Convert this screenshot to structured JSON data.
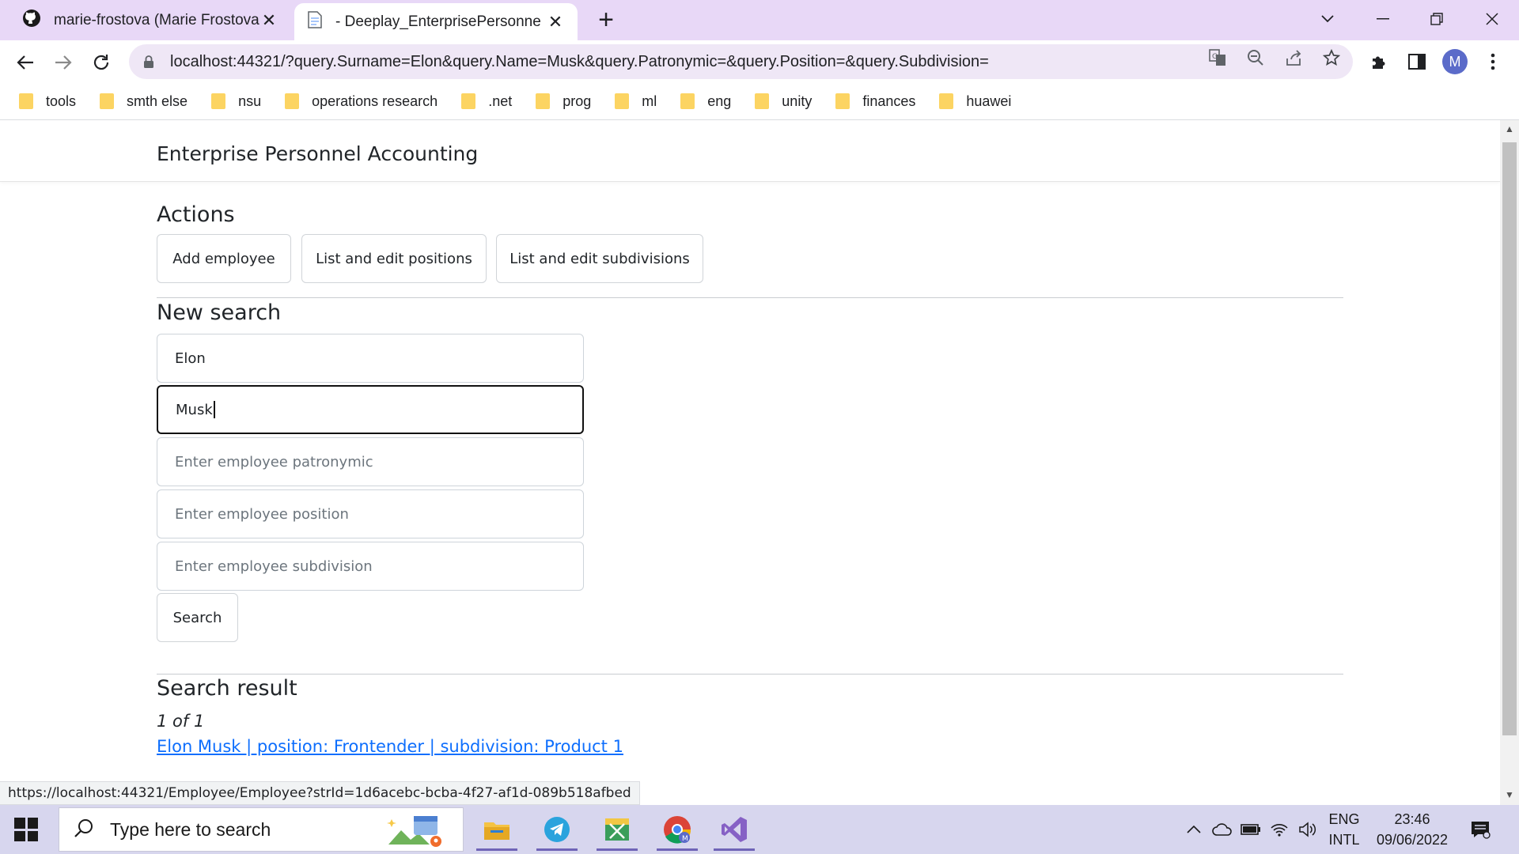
{
  "browser": {
    "tabs": [
      {
        "title": "marie-frostova (Marie Frostova)",
        "icon": "github-icon",
        "active": false
      },
      {
        "title": "- Deeplay_EnterprisePersonnelAc",
        "icon": "page-icon",
        "active": true
      }
    ],
    "url": "localhost:44321/?query.Surname=Elon&query.Name=Musk&query.Patronymic=&query.Position=&query.Subdivision=",
    "profile_initial": "M",
    "bookmarks": [
      "tools",
      "smth else",
      "nsu",
      "operations research",
      ".net",
      "prog",
      "ml",
      "eng",
      "unity",
      "finances",
      "huawei"
    ],
    "status_url": "https://localhost:44321/Employee/Employee?strId=1d6acebc-bcba-4f27-af1d-089b518afbed"
  },
  "app": {
    "brand": "Enterprise Personnel Accounting",
    "actions_heading": "Actions",
    "actions": [
      "Add employee",
      "List and edit positions",
      "List and edit subdivisions"
    ],
    "search_heading": "New search",
    "fields": {
      "surname_value": "Elon",
      "name_value": "Musk",
      "patronymic_placeholder": "Enter employee patronymic",
      "position_placeholder": "Enter employee position",
      "subdivision_placeholder": "Enter employee subdivision"
    },
    "search_button": "Search",
    "result_heading": "Search result",
    "result_count": "1 of 1",
    "result_link": "Elon Musk | position: Frontender | subdivision: Product 1"
  },
  "taskbar": {
    "search_placeholder": "Type here to search",
    "lang_top": "ENG",
    "lang_bottom": "INTL",
    "time": "23:46",
    "date": "09/06/2022"
  },
  "colors": {
    "tabstrip": "#e8d8f7",
    "link": "#0d6efd",
    "taskbar": "#d7d6ee"
  }
}
